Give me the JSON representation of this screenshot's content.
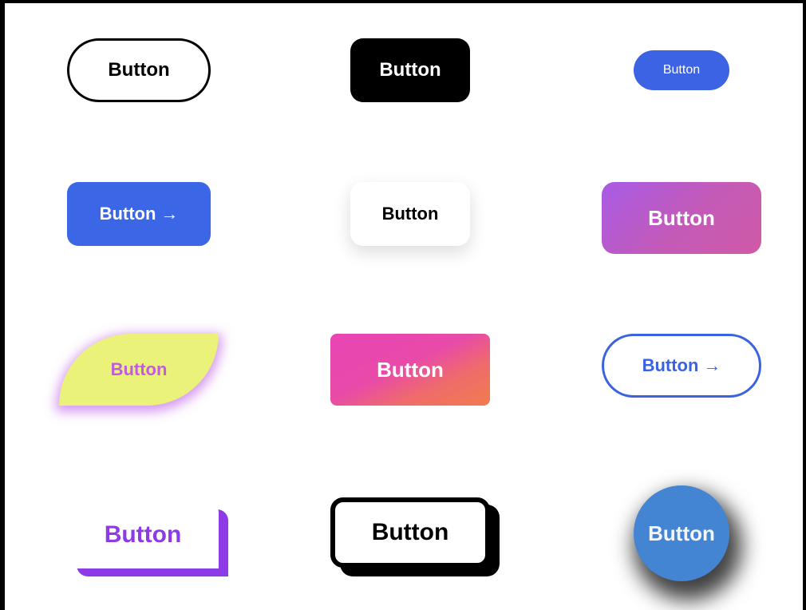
{
  "buttons": {
    "outline_pill": {
      "label": "Button"
    },
    "black_rounded": {
      "label": "Button"
    },
    "small_blue_pill": {
      "label": "Button"
    },
    "blue_arrow": {
      "label": "Button",
      "arrow": "→"
    },
    "white_shadow": {
      "label": "Button"
    },
    "purple_gradient": {
      "label": "Button"
    },
    "yellow_leaf": {
      "label": "Button"
    },
    "pink_orange_gradient": {
      "label": "Button"
    },
    "blue_outline_arrow": {
      "label": "Button",
      "arrow": "→"
    },
    "purple_offset_shadow": {
      "label": "Button"
    },
    "black_offset_outline": {
      "label": "Button"
    },
    "blue_circle": {
      "label": "Button"
    }
  },
  "colors": {
    "blue": "#3b66e5",
    "purple": "#8c3be6",
    "yellow": "#eaf27a",
    "pink": "#e845b5",
    "orange": "#f07c4e",
    "circle_blue": "#4485d3"
  }
}
